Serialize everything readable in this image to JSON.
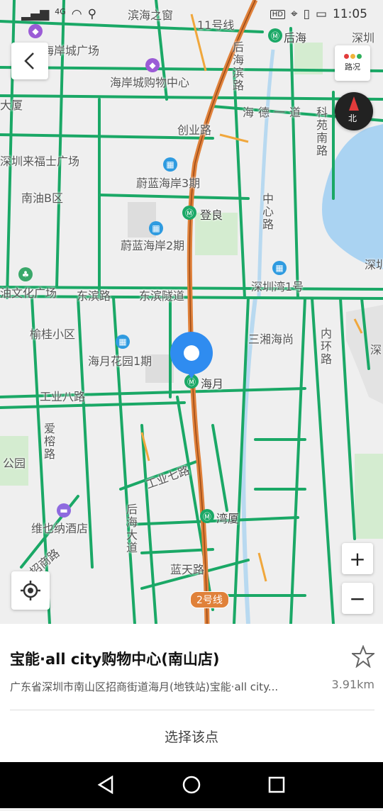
{
  "status_bar": {
    "signal_text": "4G",
    "time": "11:05",
    "hd_badge": "HD"
  },
  "map": {
    "labels": [
      {
        "text": "滨海之窗",
        "name": "label-binhaizhichuang"
      },
      {
        "text": "11号线",
        "name": "label-line11"
      },
      {
        "text": "后海",
        "name": "label-houhai-station"
      },
      {
        "text": "深圳",
        "name": "label-shenzhen-top"
      },
      {
        "text": "海岸城广场",
        "name": "label-haianchengguangchang"
      },
      {
        "text": "后海滨路",
        "name": "label-houhaibinlu"
      },
      {
        "text": "海岸城购物中心",
        "name": "label-haianchenggouwuzhongxin"
      },
      {
        "text": "大厦",
        "name": "label-dasha"
      },
      {
        "text": "海德一道",
        "name": "label-haideyidao"
      },
      {
        "text": "科苑南路",
        "name": "label-keyuannanlu"
      },
      {
        "text": "创业路",
        "name": "label-chuangyelu"
      },
      {
        "text": "深圳来福士广场",
        "name": "label-laifushi"
      },
      {
        "text": "蔚蓝海岸3期",
        "name": "label-weilan3"
      },
      {
        "text": "南油B区",
        "name": "label-nanyoubqu"
      },
      {
        "text": "登良",
        "name": "label-dengliang-station"
      },
      {
        "text": "中心路",
        "name": "label-zhongxinlu"
      },
      {
        "text": "蔚蓝海岸2期",
        "name": "label-weilan2"
      },
      {
        "text": "深圳",
        "name": "label-shenzhen-right"
      },
      {
        "text": "油文化广场",
        "name": "label-youwenhua"
      },
      {
        "text": "东滨路",
        "name": "label-dongbinlu"
      },
      {
        "text": "东滨隧道",
        "name": "label-dongbinsuidao"
      },
      {
        "text": "深圳湾1号",
        "name": "label-shenzhenwan1hao"
      },
      {
        "text": "榆桂小区",
        "name": "label-yuguixiaoqu"
      },
      {
        "text": "三湘海尚",
        "name": "label-sanxianghaishang"
      },
      {
        "text": "内环路",
        "name": "label-neihuanlu"
      },
      {
        "text": "深",
        "name": "label-shen-edge"
      },
      {
        "text": "海月花园1期",
        "name": "label-haiyuehuayuan"
      },
      {
        "text": "海月",
        "name": "label-haiyue-station"
      },
      {
        "text": "工业八路",
        "name": "label-gongyebalu"
      },
      {
        "text": "爱榕路",
        "name": "label-aironglu"
      },
      {
        "text": "公园",
        "name": "label-gongyuan"
      },
      {
        "text": "工业七路",
        "name": "label-gongyeqilu"
      },
      {
        "text": "维也纳酒店",
        "name": "label-weiyena"
      },
      {
        "text": "后海大道",
        "name": "label-houhaidadao"
      },
      {
        "text": "湾厦",
        "name": "label-wanxia-station"
      },
      {
        "text": "招商路",
        "name": "label-zhaoshanglu"
      },
      {
        "text": "蓝天路",
        "name": "label-lantianlu"
      },
      {
        "text": "2号线",
        "name": "label-line2"
      }
    ],
    "traffic_button": "路况",
    "compass_label": "北",
    "zoom_in": "+",
    "zoom_out": "−"
  },
  "place": {
    "title": "宝能·all city购物中心(南山店)",
    "address": "广东省深圳市南山区招商街道海月(地铁站)宝能·all city...",
    "distance": "3.91km"
  },
  "action": {
    "select_label": "选择该点"
  },
  "colors": {
    "road_green": "#1aa866",
    "metro_orange": "#e0813a",
    "pin_blue": "#2f8cf0",
    "water": "#aad3f2"
  }
}
